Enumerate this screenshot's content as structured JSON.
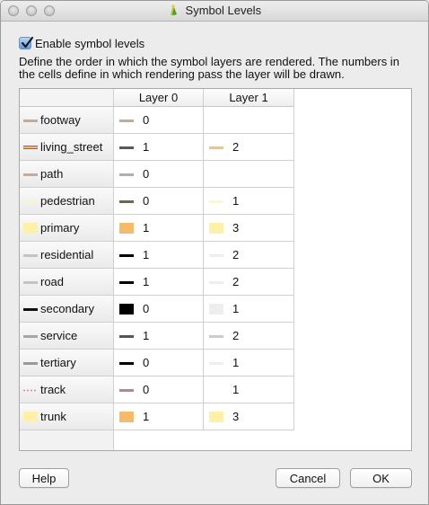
{
  "window": {
    "title": "Symbol Levels"
  },
  "enable_checkbox": {
    "label": "Enable symbol levels",
    "checked": true
  },
  "description": "Define the order in which the symbol layers are rendered. The numbers in the cells define in which rendering pass the layer will be drawn.",
  "columns": [
    "Layer 0",
    "Layer 1"
  ],
  "rows": [
    {
      "name": "footway",
      "icon": {
        "type": "line",
        "color": "#c9a99a"
      },
      "layers": [
        {
          "type": "line",
          "color": "#c9a99a",
          "value": "0"
        },
        null
      ]
    },
    {
      "name": "living_street",
      "icon": {
        "type": "line2",
        "color": "#8b6a74",
        "color2": "#f0b95e"
      },
      "layers": [
        {
          "type": "line",
          "color": "#5b5566",
          "value": "1"
        },
        {
          "type": "line",
          "color": "#f3c57a",
          "value": "2"
        }
      ]
    },
    {
      "name": "path",
      "icon": {
        "type": "line",
        "color": "#c9a99a"
      },
      "layers": [
        {
          "type": "line",
          "color": "#bbaaa5",
          "value": "0"
        },
        null
      ]
    },
    {
      "name": "pedestrian",
      "icon": {
        "type": "line",
        "color": "#fbf5c2"
      },
      "layers": [
        {
          "type": "line",
          "color": "#6a6a46",
          "value": "0"
        },
        {
          "type": "line",
          "color": "#fdf8c6",
          "value": "1"
        }
      ]
    },
    {
      "name": "primary",
      "icon": {
        "type": "fill",
        "color": "#fdf0a9"
      },
      "layers": [
        {
          "type": "fill",
          "color": "#f6bb6a",
          "value": "1"
        },
        {
          "type": "fill",
          "color": "#fdf0a9",
          "value": "3"
        }
      ]
    },
    {
      "name": "residential",
      "icon": {
        "type": "line",
        "color": "#c4c4c4"
      },
      "layers": [
        {
          "type": "line",
          "color": "#000000",
          "value": "1"
        },
        {
          "type": "line",
          "color": "#eeeeee",
          "value": "2"
        }
      ]
    },
    {
      "name": "road",
      "icon": {
        "type": "line",
        "color": "#c4c4c4"
      },
      "layers": [
        {
          "type": "line",
          "color": "#000000",
          "value": "1"
        },
        {
          "type": "line",
          "color": "#eeeeee",
          "value": "2"
        }
      ]
    },
    {
      "name": "secondary",
      "icon": {
        "type": "line",
        "color": "#111111"
      },
      "layers": [
        {
          "type": "fill",
          "color": "#000000",
          "value": "0"
        },
        {
          "type": "fill",
          "color": "#eeeeee",
          "value": "1"
        }
      ]
    },
    {
      "name": "service",
      "icon": {
        "type": "line",
        "color": "#a6a6a6"
      },
      "layers": [
        {
          "type": "line",
          "color": "#555555",
          "value": "1"
        },
        {
          "type": "line",
          "color": "#cccccc",
          "value": "2"
        }
      ]
    },
    {
      "name": "tertiary",
      "icon": {
        "type": "line",
        "color": "#9a9a9a"
      },
      "layers": [
        {
          "type": "line",
          "color": "#000000",
          "value": "0"
        },
        {
          "type": "line",
          "color": "#eeeeee",
          "value": "1"
        }
      ]
    },
    {
      "name": "track",
      "icon": {
        "type": "dash",
        "color": "#d48aa0"
      },
      "layers": [
        {
          "type": "line",
          "color": "#b4859a",
          "value": "0"
        },
        {
          "type": "none",
          "color": "#ffffff",
          "value": "1"
        }
      ]
    },
    {
      "name": "trunk",
      "icon": {
        "type": "fill",
        "color": "#fdf0a9"
      },
      "layers": [
        {
          "type": "fill",
          "color": "#f6bb6a",
          "value": "1"
        },
        {
          "type": "fill",
          "color": "#fdf0a9",
          "value": "3"
        }
      ]
    }
  ],
  "buttons": {
    "help": "Help",
    "cancel": "Cancel",
    "ok": "OK"
  }
}
